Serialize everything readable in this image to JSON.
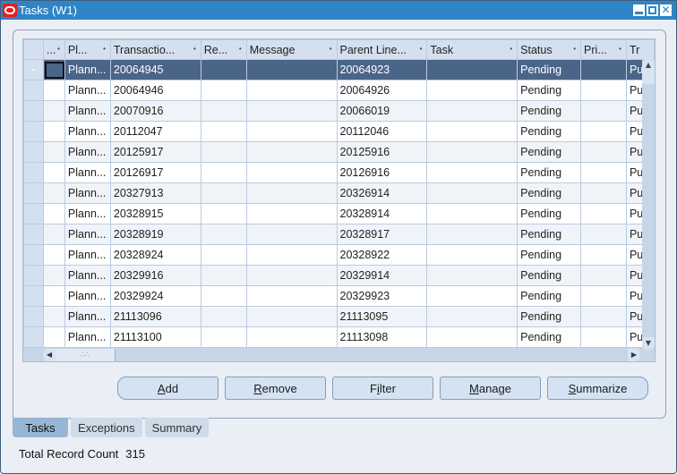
{
  "window": {
    "title": "Tasks (W1)",
    "controls": [
      "minimize",
      "maximize",
      "close"
    ]
  },
  "grid": {
    "columns": [
      {
        "label": "...",
        "key": "flag"
      },
      {
        "label": "Pl...",
        "key": "plan"
      },
      {
        "label": "Transactio...",
        "key": "transaction"
      },
      {
        "label": "Re...",
        "key": "re"
      },
      {
        "label": "Message",
        "key": "message"
      },
      {
        "label": "Parent Line...",
        "key": "parent_line"
      },
      {
        "label": "Task",
        "key": "task"
      },
      {
        "label": "Status",
        "key": "status"
      },
      {
        "label": "Pri...",
        "key": "priority"
      },
      {
        "label": "Tr",
        "key": "tr"
      }
    ],
    "selected_row": 0,
    "rows": [
      {
        "plan": "Plann...",
        "transaction": "20064945",
        "re": "",
        "message": "",
        "parent_line": "20064923",
        "task": "",
        "status": "Pending",
        "priority": "",
        "tr": "Pu"
      },
      {
        "plan": "Plann...",
        "transaction": "20064946",
        "re": "",
        "message": "",
        "parent_line": "20064926",
        "task": "",
        "status": "Pending",
        "priority": "",
        "tr": "Pu"
      },
      {
        "plan": "Plann...",
        "transaction": "20070916",
        "re": "",
        "message": "",
        "parent_line": "20066019",
        "task": "",
        "status": "Pending",
        "priority": "",
        "tr": "Pu"
      },
      {
        "plan": "Plann...",
        "transaction": "20112047",
        "re": "",
        "message": "",
        "parent_line": "20112046",
        "task": "",
        "status": "Pending",
        "priority": "",
        "tr": "Pu"
      },
      {
        "plan": "Plann...",
        "transaction": "20125917",
        "re": "",
        "message": "",
        "parent_line": "20125916",
        "task": "",
        "status": "Pending",
        "priority": "",
        "tr": "Pu"
      },
      {
        "plan": "Plann...",
        "transaction": "20126917",
        "re": "",
        "message": "",
        "parent_line": "20126916",
        "task": "",
        "status": "Pending",
        "priority": "",
        "tr": "Pu"
      },
      {
        "plan": "Plann...",
        "transaction": "20327913",
        "re": "",
        "message": "",
        "parent_line": "20326914",
        "task": "",
        "status": "Pending",
        "priority": "",
        "tr": "Pu"
      },
      {
        "plan": "Plann...",
        "transaction": "20328915",
        "re": "",
        "message": "",
        "parent_line": "20328914",
        "task": "",
        "status": "Pending",
        "priority": "",
        "tr": "Pu"
      },
      {
        "plan": "Plann...",
        "transaction": "20328919",
        "re": "",
        "message": "",
        "parent_line": "20328917",
        "task": "",
        "status": "Pending",
        "priority": "",
        "tr": "Pu"
      },
      {
        "plan": "Plann...",
        "transaction": "20328924",
        "re": "",
        "message": "",
        "parent_line": "20328922",
        "task": "",
        "status": "Pending",
        "priority": "",
        "tr": "Pu"
      },
      {
        "plan": "Plann...",
        "transaction": "20329916",
        "re": "",
        "message": "",
        "parent_line": "20329914",
        "task": "",
        "status": "Pending",
        "priority": "",
        "tr": "Pu"
      },
      {
        "plan": "Plann...",
        "transaction": "20329924",
        "re": "",
        "message": "",
        "parent_line": "20329923",
        "task": "",
        "status": "Pending",
        "priority": "",
        "tr": "Pu"
      },
      {
        "plan": "Plann...",
        "transaction": "21113096",
        "re": "",
        "message": "",
        "parent_line": "21113095",
        "task": "",
        "status": "Pending",
        "priority": "",
        "tr": "Pu"
      },
      {
        "plan": "Plann...",
        "transaction": "21113100",
        "re": "",
        "message": "",
        "parent_line": "21113098",
        "task": "",
        "status": "Pending",
        "priority": "",
        "tr": "Pu"
      }
    ]
  },
  "buttons": [
    {
      "id": "add",
      "pre": "",
      "mnemonic": "A",
      "post": "dd"
    },
    {
      "id": "remove",
      "pre": "",
      "mnemonic": "R",
      "post": "emove"
    },
    {
      "id": "filter",
      "pre": "F",
      "mnemonic": "i",
      "post": "lter"
    },
    {
      "id": "manage",
      "pre": "",
      "mnemonic": "M",
      "post": "anage"
    },
    {
      "id": "summarize",
      "pre": "",
      "mnemonic": "S",
      "post": "ummarize"
    }
  ],
  "tabs": [
    {
      "label": "Tasks",
      "active": true
    },
    {
      "label": "Exceptions",
      "active": false
    },
    {
      "label": "Summary",
      "active": false
    }
  ],
  "footer": {
    "record_count_label": "Total Record Count",
    "record_count_value": "315"
  }
}
